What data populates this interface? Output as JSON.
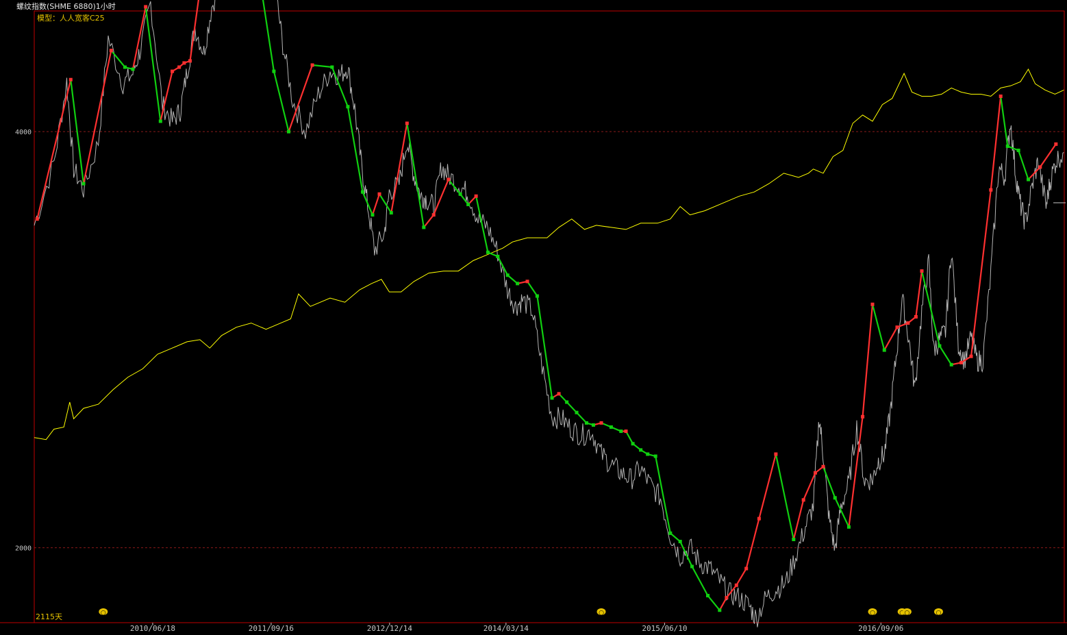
{
  "window": {
    "title": "螺纹指数(SHME 6880)1小时"
  },
  "model_label": "模型：人人宽客C25",
  "days_label": "2115天",
  "colors": {
    "background": "#000000",
    "frame": "#c00000",
    "price": "#b4b4b4",
    "equity": "#ffff00",
    "up_segment": "#ff3030",
    "down_segment": "#10d010",
    "gridline": "#8b1a1a",
    "label_yellow": "#e5c100"
  },
  "chart_data": {
    "type": "line",
    "title": "螺纹指数(SHME 6880)1小时",
    "ylim": [
      1640,
      4580
    ],
    "y_ticks": [
      4000,
      2000
    ],
    "x_ticks": [
      "2010/06/18",
      "2011/09/16",
      "2012/12/14",
      "2014/03/14",
      "2015/06/10",
      "2016/09/06"
    ],
    "x_tick_pos": [
      0.115,
      0.23,
      0.345,
      0.458,
      0.612,
      0.822
    ],
    "grid": "horizontal dashed at y ticks",
    "legend": "none",
    "series": [
      {
        "role": "price",
        "style": "thin grey",
        "points": [
          [
            0.0,
            3550
          ],
          [
            0.02,
            3850
          ],
          [
            0.033,
            4240
          ],
          [
            0.04,
            3820
          ],
          [
            0.05,
            3720
          ],
          [
            0.065,
            3950
          ],
          [
            0.075,
            4450
          ],
          [
            0.09,
            4230
          ],
          [
            0.1,
            4280
          ],
          [
            0.108,
            4400
          ],
          [
            0.118,
            4620
          ],
          [
            0.13,
            4130
          ],
          [
            0.14,
            4050
          ],
          [
            0.148,
            4100
          ],
          [
            0.155,
            4290
          ],
          [
            0.163,
            4500
          ],
          [
            0.172,
            4380
          ],
          [
            0.18,
            4600
          ],
          [
            0.19,
            4730
          ],
          [
            0.2,
            4870
          ],
          [
            0.21,
            4720
          ],
          [
            0.222,
            4780
          ],
          [
            0.232,
            4930
          ],
          [
            0.244,
            4700
          ],
          [
            0.252,
            4420
          ],
          [
            0.262,
            4150
          ],
          [
            0.275,
            4000
          ],
          [
            0.288,
            4180
          ],
          [
            0.3,
            4290
          ],
          [
            0.31,
            4270
          ],
          [
            0.318,
            4310
          ],
          [
            0.325,
            4110
          ],
          [
            0.332,
            3830
          ],
          [
            0.338,
            3650
          ],
          [
            0.345,
            3430
          ],
          [
            0.355,
            3510
          ],
          [
            0.36,
            3710
          ],
          [
            0.37,
            3750
          ],
          [
            0.378,
            3960
          ],
          [
            0.385,
            3790
          ],
          [
            0.392,
            3690
          ],
          [
            0.397,
            3680
          ],
          [
            0.405,
            3640
          ],
          [
            0.413,
            3830
          ],
          [
            0.42,
            3790
          ],
          [
            0.432,
            3740
          ],
          [
            0.44,
            3700
          ],
          [
            0.45,
            3580
          ],
          [
            0.46,
            3540
          ],
          [
            0.47,
            3420
          ],
          [
            0.48,
            3240
          ],
          [
            0.488,
            3160
          ],
          [
            0.495,
            3190
          ],
          [
            0.505,
            3140
          ],
          [
            0.515,
            2870
          ],
          [
            0.525,
            2630
          ],
          [
            0.535,
            2620
          ],
          [
            0.545,
            2570
          ],
          [
            0.555,
            2540
          ],
          [
            0.565,
            2560
          ],
          [
            0.575,
            2450
          ],
          [
            0.585,
            2400
          ],
          [
            0.595,
            2360
          ],
          [
            0.605,
            2330
          ],
          [
            0.615,
            2380
          ],
          [
            0.625,
            2300
          ],
          [
            0.635,
            2240
          ],
          [
            0.645,
            2060
          ],
          [
            0.655,
            1960
          ],
          [
            0.665,
            2000
          ],
          [
            0.675,
            1930
          ],
          [
            0.685,
            1900
          ],
          [
            0.695,
            1840
          ],
          [
            0.705,
            1780
          ],
          [
            0.715,
            1760
          ],
          [
            0.725,
            1720
          ],
          [
            0.732,
            1660
          ],
          [
            0.742,
            1760
          ],
          [
            0.752,
            1800
          ],
          [
            0.762,
            1830
          ],
          [
            0.772,
            1960
          ],
          [
            0.782,
            2100
          ],
          [
            0.79,
            2200
          ],
          [
            0.796,
            2630
          ],
          [
            0.8,
            2450
          ],
          [
            0.806,
            2140
          ],
          [
            0.812,
            1990
          ],
          [
            0.818,
            2200
          ],
          [
            0.826,
            2310
          ],
          [
            0.834,
            2580
          ],
          [
            0.842,
            2320
          ],
          [
            0.85,
            2330
          ],
          [
            0.856,
            2420
          ],
          [
            0.862,
            2450
          ],
          [
            0.868,
            2650
          ],
          [
            0.874,
            2920
          ],
          [
            0.88,
            3200
          ],
          [
            0.887,
            3000
          ],
          [
            0.893,
            2760
          ],
          [
            0.9,
            3140
          ],
          [
            0.907,
            3370
          ],
          [
            0.912,
            2950
          ],
          [
            0.918,
            3000
          ],
          [
            0.924,
            3040
          ],
          [
            0.93,
            3440
          ],
          [
            0.937,
            2980
          ],
          [
            0.943,
            2900
          ],
          [
            0.95,
            3010
          ],
          [
            0.956,
            2900
          ],
          [
            0.962,
            2900
          ],
          [
            0.97,
            3320
          ],
          [
            0.978,
            3830
          ],
          [
            0.984,
            3780
          ],
          [
            0.99,
            4050
          ],
          [
            0.995,
            3800
          ],
          [
            1.0,
            3650
          ],
          [
            1.005,
            3560
          ],
          [
            1.012,
            3740
          ],
          [
            1.018,
            3860
          ],
          [
            1.026,
            3640
          ],
          [
            1.03,
            3760
          ],
          [
            1.036,
            3860
          ],
          [
            1.044,
            3900
          ]
        ]
      },
      {
        "role": "equity",
        "style": "thin yellow",
        "points": [
          [
            0.0,
            2530
          ],
          [
            0.012,
            2520
          ],
          [
            0.02,
            2570
          ],
          [
            0.03,
            2580
          ],
          [
            0.036,
            2700
          ],
          [
            0.04,
            2620
          ],
          [
            0.05,
            2670
          ],
          [
            0.065,
            2690
          ],
          [
            0.08,
            2760
          ],
          [
            0.095,
            2820
          ],
          [
            0.11,
            2860
          ],
          [
            0.125,
            2930
          ],
          [
            0.14,
            2960
          ],
          [
            0.155,
            2990
          ],
          [
            0.168,
            3000
          ],
          [
            0.178,
            2960
          ],
          [
            0.19,
            3020
          ],
          [
            0.205,
            3060
          ],
          [
            0.22,
            3080
          ],
          [
            0.235,
            3050
          ],
          [
            0.25,
            3080
          ],
          [
            0.26,
            3100
          ],
          [
            0.268,
            3220
          ],
          [
            0.28,
            3160
          ],
          [
            0.3,
            3200
          ],
          [
            0.315,
            3180
          ],
          [
            0.33,
            3240
          ],
          [
            0.342,
            3270
          ],
          [
            0.352,
            3290
          ],
          [
            0.36,
            3230
          ],
          [
            0.372,
            3230
          ],
          [
            0.385,
            3280
          ],
          [
            0.4,
            3320
          ],
          [
            0.415,
            3330
          ],
          [
            0.43,
            3330
          ],
          [
            0.445,
            3380
          ],
          [
            0.46,
            3410
          ],
          [
            0.475,
            3440
          ],
          [
            0.485,
            3470
          ],
          [
            0.5,
            3490
          ],
          [
            0.52,
            3490
          ],
          [
            0.532,
            3540
          ],
          [
            0.545,
            3580
          ],
          [
            0.558,
            3530
          ],
          [
            0.57,
            3550
          ],
          [
            0.585,
            3540
          ],
          [
            0.6,
            3530
          ],
          [
            0.615,
            3560
          ],
          [
            0.632,
            3560
          ],
          [
            0.645,
            3580
          ],
          [
            0.655,
            3640
          ],
          [
            0.665,
            3600
          ],
          [
            0.68,
            3620
          ],
          [
            0.7,
            3660
          ],
          [
            0.715,
            3690
          ],
          [
            0.73,
            3710
          ],
          [
            0.745,
            3750
          ],
          [
            0.76,
            3800
          ],
          [
            0.775,
            3780
          ],
          [
            0.785,
            3800
          ],
          [
            0.79,
            3820
          ],
          [
            0.8,
            3800
          ],
          [
            0.81,
            3880
          ],
          [
            0.82,
            3910
          ],
          [
            0.83,
            4040
          ],
          [
            0.84,
            4080
          ],
          [
            0.85,
            4050
          ],
          [
            0.86,
            4130
          ],
          [
            0.87,
            4160
          ],
          [
            0.882,
            4280
          ],
          [
            0.89,
            4190
          ],
          [
            0.9,
            4170
          ],
          [
            0.91,
            4170
          ],
          [
            0.92,
            4180
          ],
          [
            0.93,
            4210
          ],
          [
            0.94,
            4190
          ],
          [
            0.95,
            4180
          ],
          [
            0.96,
            4180
          ],
          [
            0.97,
            4170
          ],
          [
            0.98,
            4210
          ],
          [
            0.99,
            4220
          ],
          [
            1.0,
            4240
          ],
          [
            1.008,
            4300
          ],
          [
            1.015,
            4230
          ],
          [
            1.025,
            4200
          ],
          [
            1.035,
            4180
          ],
          [
            1.044,
            4200
          ]
        ]
      },
      {
        "role": "signal",
        "style": "zigzag, red up / green down",
        "points": [
          [
            0.003,
            3580
          ],
          [
            0.037,
            4250
          ],
          [
            0.05,
            3750
          ],
          [
            0.078,
            4390
          ],
          [
            0.092,
            4310
          ],
          [
            0.1,
            4300
          ],
          [
            0.113,
            4600
          ],
          [
            0.128,
            4050
          ],
          [
            0.14,
            4290
          ],
          [
            0.147,
            4310
          ],
          [
            0.152,
            4330
          ],
          [
            0.158,
            4340
          ],
          [
            0.175,
            4920
          ],
          [
            0.188,
            4800
          ],
          [
            0.2,
            4790
          ],
          [
            0.212,
            4780
          ],
          [
            0.225,
            4850
          ],
          [
            0.243,
            4290
          ],
          [
            0.258,
            4000
          ],
          [
            0.282,
            4320
          ],
          [
            0.302,
            4310
          ],
          [
            0.318,
            4120
          ],
          [
            0.333,
            3710
          ],
          [
            0.343,
            3600
          ],
          [
            0.35,
            3700
          ],
          [
            0.362,
            3610
          ],
          [
            0.378,
            4040
          ],
          [
            0.395,
            3540
          ],
          [
            0.405,
            3600
          ],
          [
            0.42,
            3770
          ],
          [
            0.432,
            3700
          ],
          [
            0.44,
            3650
          ],
          [
            0.448,
            3690
          ],
          [
            0.46,
            3420
          ],
          [
            0.47,
            3400
          ],
          [
            0.48,
            3310
          ],
          [
            0.49,
            3270
          ],
          [
            0.5,
            3280
          ],
          [
            0.51,
            3210
          ],
          [
            0.525,
            2720
          ],
          [
            0.532,
            2740
          ],
          [
            0.54,
            2700
          ],
          [
            0.55,
            2650
          ],
          [
            0.56,
            2600
          ],
          [
            0.567,
            2590
          ],
          [
            0.575,
            2600
          ],
          [
            0.585,
            2580
          ],
          [
            0.595,
            2560
          ],
          [
            0.6,
            2560
          ],
          [
            0.607,
            2500
          ],
          [
            0.615,
            2470
          ],
          [
            0.622,
            2450
          ],
          [
            0.63,
            2440
          ],
          [
            0.645,
            2070
          ],
          [
            0.655,
            2030
          ],
          [
            0.667,
            1910
          ],
          [
            0.683,
            1770
          ],
          [
            0.695,
            1700
          ],
          [
            0.702,
            1760
          ],
          [
            0.712,
            1820
          ],
          [
            0.722,
            1900
          ],
          [
            0.735,
            2140
          ],
          [
            0.752,
            2450
          ],
          [
            0.77,
            2040
          ],
          [
            0.78,
            2230
          ],
          [
            0.792,
            2360
          ],
          [
            0.8,
            2390
          ],
          [
            0.812,
            2240
          ],
          [
            0.826,
            2100
          ],
          [
            0.84,
            2630
          ],
          [
            0.85,
            3170
          ],
          [
            0.862,
            2950
          ],
          [
            0.875,
            3060
          ],
          [
            0.886,
            3080
          ],
          [
            0.894,
            3110
          ],
          [
            0.9,
            3330
          ],
          [
            0.918,
            2970
          ],
          [
            0.93,
            2880
          ],
          [
            0.94,
            2890
          ],
          [
            0.95,
            2920
          ],
          [
            0.97,
            3720
          ],
          [
            0.98,
            4170
          ],
          [
            0.987,
            3930
          ],
          [
            0.998,
            3910
          ],
          [
            1.008,
            3770
          ],
          [
            1.02,
            3830
          ],
          [
            1.036,
            3940
          ]
        ]
      }
    ],
    "markers": [
      {
        "x": 0.07,
        "label": "○"
      },
      {
        "x": 0.575,
        "label": "○"
      },
      {
        "x": 0.85,
        "label": "○"
      },
      {
        "x": 0.88,
        "label": "○"
      },
      {
        "x": 0.885,
        "label": "○"
      },
      {
        "x": 0.917,
        "label": "○"
      }
    ]
  }
}
